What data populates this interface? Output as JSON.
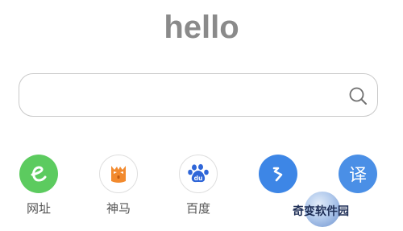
{
  "logo": {
    "text": "hello"
  },
  "search": {
    "value": "",
    "placeholder": "",
    "icon": "search-icon"
  },
  "shortcuts": [
    {
      "label": "网址",
      "icon": "e-browser-icon",
      "color": "#5ccb5f"
    },
    {
      "label": "神马",
      "icon": "shenma-icon",
      "color": "#f28a2e"
    },
    {
      "label": "百度",
      "icon": "baidu-paw-icon",
      "color": "#2f66d8"
    },
    {
      "label": "",
      "icon": "arrow-launch-icon",
      "color": "#3d86e6"
    },
    {
      "label": "",
      "icon": "translate-icon",
      "color": "#4a8fe6",
      "glyph": "译"
    }
  ],
  "watermark": {
    "text": "奇变软件园"
  }
}
